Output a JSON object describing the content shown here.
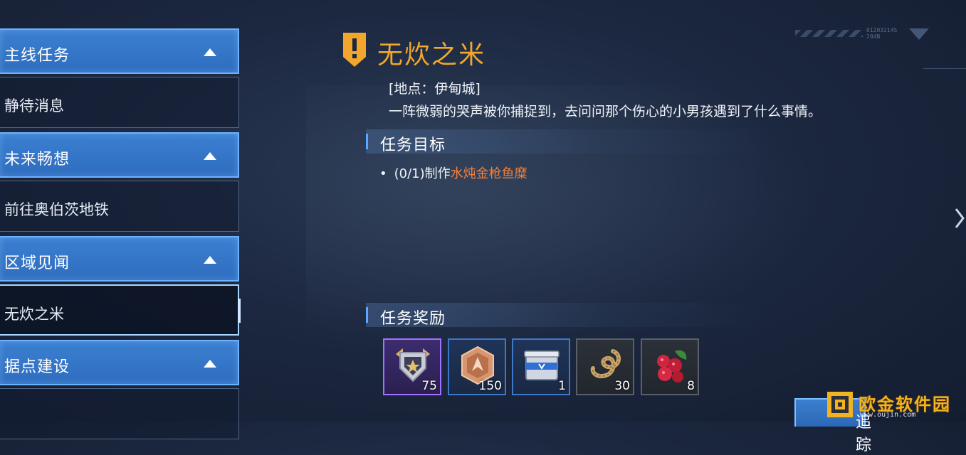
{
  "hud": {
    "code_top": "01203214S",
    "code_bottom": "204B"
  },
  "sidebar": {
    "groups": [
      {
        "category": "主线任务",
        "quest": "静待消息"
      },
      {
        "category": "未来畅想",
        "quest": "前往奥伯茨地铁"
      },
      {
        "category": "区域见闻",
        "quest": "无炊之米"
      },
      {
        "category": "据点建设",
        "quest": ""
      }
    ]
  },
  "quest": {
    "title": "无炊之米",
    "location": "[地点：伊甸城]",
    "description": "一阵微弱的哭声被你捕捉到，去问问那个伤心的小男孩遇到了什么事情。",
    "objective_header": "任务目标",
    "objective_bullet": "•",
    "objective_progress": "(0/1)制作",
    "objective_target": "水炖金枪鱼糜",
    "reward_header": "任务奖励",
    "rewards": [
      {
        "icon": "shield-badge-icon",
        "count": "75"
      },
      {
        "icon": "hex-coin-icon",
        "count": "150"
      },
      {
        "icon": "supply-crate-icon",
        "count": "1"
      },
      {
        "icon": "rope-coil-icon",
        "count": "30"
      },
      {
        "icon": "raspberry-icon",
        "count": "8"
      }
    ]
  },
  "track_button": {
    "label": "追踪"
  },
  "watermark": {
    "text": "欧金软件园",
    "url": "www.oujin.com"
  },
  "colors": {
    "accent": "#f2a62b",
    "target": "#f2813a",
    "sidebar_blue": "#3b7fd0"
  }
}
